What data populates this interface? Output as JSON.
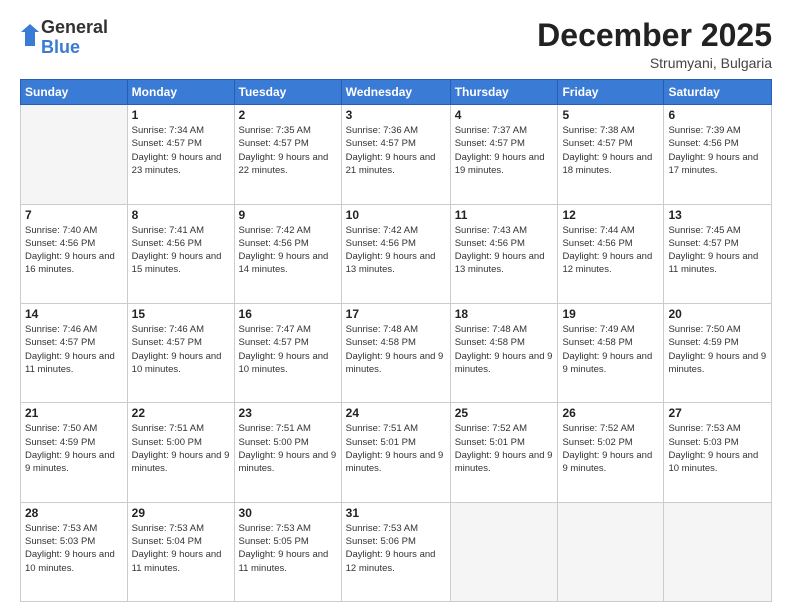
{
  "header": {
    "logo": {
      "general": "General",
      "blue": "Blue"
    },
    "title": "December 2025",
    "location": "Strumyani, Bulgaria"
  },
  "weekdays": [
    "Sunday",
    "Monday",
    "Tuesday",
    "Wednesday",
    "Thursday",
    "Friday",
    "Saturday"
  ],
  "weeks": [
    [
      {
        "day": "",
        "empty": true
      },
      {
        "day": "1",
        "sunrise": "7:34 AM",
        "sunset": "4:57 PM",
        "daylight": "9 hours and 23 minutes."
      },
      {
        "day": "2",
        "sunrise": "7:35 AM",
        "sunset": "4:57 PM",
        "daylight": "9 hours and 22 minutes."
      },
      {
        "day": "3",
        "sunrise": "7:36 AM",
        "sunset": "4:57 PM",
        "daylight": "9 hours and 21 minutes."
      },
      {
        "day": "4",
        "sunrise": "7:37 AM",
        "sunset": "4:57 PM",
        "daylight": "9 hours and 19 minutes."
      },
      {
        "day": "5",
        "sunrise": "7:38 AM",
        "sunset": "4:57 PM",
        "daylight": "9 hours and 18 minutes."
      },
      {
        "day": "6",
        "sunrise": "7:39 AM",
        "sunset": "4:56 PM",
        "daylight": "9 hours and 17 minutes."
      }
    ],
    [
      {
        "day": "7",
        "sunrise": "7:40 AM",
        "sunset": "4:56 PM",
        "daylight": "9 hours and 16 minutes."
      },
      {
        "day": "8",
        "sunrise": "7:41 AM",
        "sunset": "4:56 PM",
        "daylight": "9 hours and 15 minutes."
      },
      {
        "day": "9",
        "sunrise": "7:42 AM",
        "sunset": "4:56 PM",
        "daylight": "9 hours and 14 minutes."
      },
      {
        "day": "10",
        "sunrise": "7:42 AM",
        "sunset": "4:56 PM",
        "daylight": "9 hours and 13 minutes."
      },
      {
        "day": "11",
        "sunrise": "7:43 AM",
        "sunset": "4:56 PM",
        "daylight": "9 hours and 13 minutes."
      },
      {
        "day": "12",
        "sunrise": "7:44 AM",
        "sunset": "4:56 PM",
        "daylight": "9 hours and 12 minutes."
      },
      {
        "day": "13",
        "sunrise": "7:45 AM",
        "sunset": "4:57 PM",
        "daylight": "9 hours and 11 minutes."
      }
    ],
    [
      {
        "day": "14",
        "sunrise": "7:46 AM",
        "sunset": "4:57 PM",
        "daylight": "9 hours and 11 minutes."
      },
      {
        "day": "15",
        "sunrise": "7:46 AM",
        "sunset": "4:57 PM",
        "daylight": "9 hours and 10 minutes."
      },
      {
        "day": "16",
        "sunrise": "7:47 AM",
        "sunset": "4:57 PM",
        "daylight": "9 hours and 10 minutes."
      },
      {
        "day": "17",
        "sunrise": "7:48 AM",
        "sunset": "4:58 PM",
        "daylight": "9 hours and 9 minutes."
      },
      {
        "day": "18",
        "sunrise": "7:48 AM",
        "sunset": "4:58 PM",
        "daylight": "9 hours and 9 minutes."
      },
      {
        "day": "19",
        "sunrise": "7:49 AM",
        "sunset": "4:58 PM",
        "daylight": "9 hours and 9 minutes."
      },
      {
        "day": "20",
        "sunrise": "7:50 AM",
        "sunset": "4:59 PM",
        "daylight": "9 hours and 9 minutes."
      }
    ],
    [
      {
        "day": "21",
        "sunrise": "7:50 AM",
        "sunset": "4:59 PM",
        "daylight": "9 hours and 9 minutes."
      },
      {
        "day": "22",
        "sunrise": "7:51 AM",
        "sunset": "5:00 PM",
        "daylight": "9 hours and 9 minutes."
      },
      {
        "day": "23",
        "sunrise": "7:51 AM",
        "sunset": "5:00 PM",
        "daylight": "9 hours and 9 minutes."
      },
      {
        "day": "24",
        "sunrise": "7:51 AM",
        "sunset": "5:01 PM",
        "daylight": "9 hours and 9 minutes."
      },
      {
        "day": "25",
        "sunrise": "7:52 AM",
        "sunset": "5:01 PM",
        "daylight": "9 hours and 9 minutes."
      },
      {
        "day": "26",
        "sunrise": "7:52 AM",
        "sunset": "5:02 PM",
        "daylight": "9 hours and 9 minutes."
      },
      {
        "day": "27",
        "sunrise": "7:53 AM",
        "sunset": "5:03 PM",
        "daylight": "9 hours and 10 minutes."
      }
    ],
    [
      {
        "day": "28",
        "sunrise": "7:53 AM",
        "sunset": "5:03 PM",
        "daylight": "9 hours and 10 minutes."
      },
      {
        "day": "29",
        "sunrise": "7:53 AM",
        "sunset": "5:04 PM",
        "daylight": "9 hours and 11 minutes."
      },
      {
        "day": "30",
        "sunrise": "7:53 AM",
        "sunset": "5:05 PM",
        "daylight": "9 hours and 11 minutes."
      },
      {
        "day": "31",
        "sunrise": "7:53 AM",
        "sunset": "5:06 PM",
        "daylight": "9 hours and 12 minutes."
      },
      {
        "day": "",
        "empty": true
      },
      {
        "day": "",
        "empty": true
      },
      {
        "day": "",
        "empty": true
      }
    ]
  ]
}
